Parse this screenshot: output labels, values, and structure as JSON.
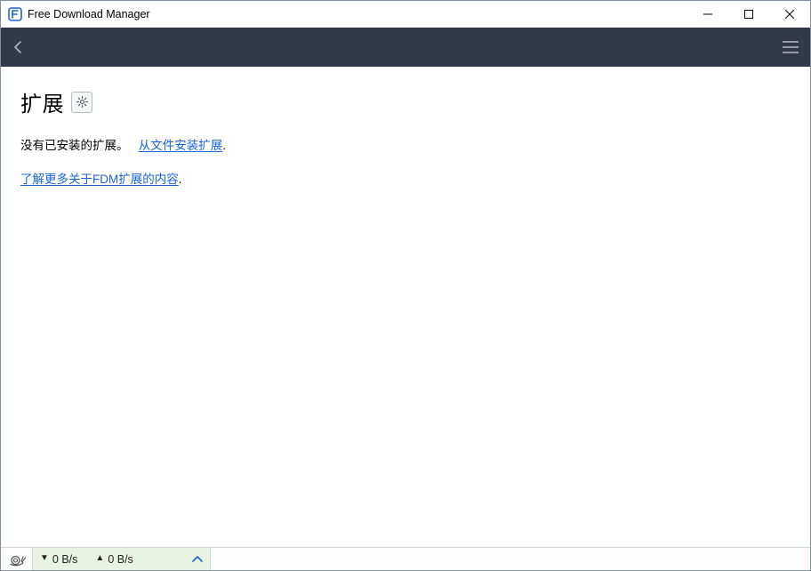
{
  "window": {
    "title": "Free Download Manager"
  },
  "colors": {
    "toolbar_bg": "#323948",
    "link": "#1a63d9",
    "speed_bg": "#e8f3e1"
  },
  "page": {
    "heading": "扩展",
    "empty_text_prefix": "没有已安装的扩展。",
    "install_link": "从文件安装扩展",
    "learn_more_link": "了解更多关于FDM扩展的内容",
    "period": "."
  },
  "status": {
    "down_label": "0 B/s",
    "up_label": "0 B/s"
  }
}
